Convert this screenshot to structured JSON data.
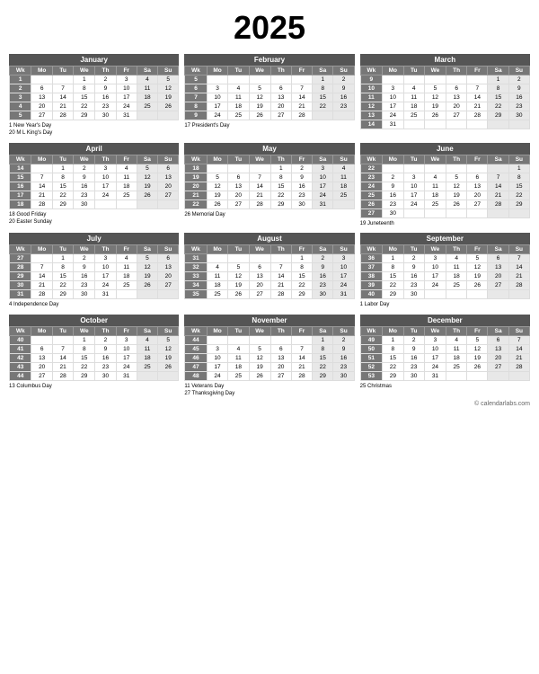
{
  "title": "2025",
  "footer": "© calendarlabs.com",
  "months": [
    {
      "name": "January",
      "headers": [
        "Wk",
        "Mo",
        "Tu",
        "We",
        "Th",
        "Fr",
        "Sa",
        "Su"
      ],
      "rows": [
        [
          "1",
          "",
          "",
          "1",
          "2",
          "3",
          "4",
          "5"
        ],
        [
          "2",
          "6",
          "7",
          "8",
          "9",
          "10",
          "11",
          "12"
        ],
        [
          "3",
          "13",
          "14",
          "15",
          "16",
          "17",
          "18",
          "19"
        ],
        [
          "4",
          "20",
          "21",
          "22",
          "23",
          "24",
          "25",
          "26"
        ],
        [
          "5",
          "27",
          "28",
          "29",
          "30",
          "31",
          "",
          ""
        ]
      ],
      "holidays": [
        "1  New Year's Day",
        "20  M L King's Day"
      ]
    },
    {
      "name": "February",
      "headers": [
        "Wk",
        "Mo",
        "Tu",
        "We",
        "Th",
        "Fr",
        "Sa",
        "Su"
      ],
      "rows": [
        [
          "5",
          "",
          "",
          "",
          "",
          "",
          "1",
          "2"
        ],
        [
          "6",
          "3",
          "4",
          "5",
          "6",
          "7",
          "8",
          "9"
        ],
        [
          "7",
          "10",
          "11",
          "12",
          "13",
          "14",
          "15",
          "16"
        ],
        [
          "8",
          "17",
          "18",
          "19",
          "20",
          "21",
          "22",
          "23"
        ],
        [
          "9",
          "24",
          "25",
          "26",
          "27",
          "28",
          "",
          ""
        ]
      ],
      "holidays": [
        "17  President's Day"
      ]
    },
    {
      "name": "March",
      "headers": [
        "Wk",
        "Mo",
        "Tu",
        "We",
        "Th",
        "Fr",
        "Sa",
        "Su"
      ],
      "rows": [
        [
          "9",
          "",
          "",
          "",
          "",
          "",
          "1",
          "2"
        ],
        [
          "10",
          "3",
          "4",
          "5",
          "6",
          "7",
          "8",
          "9"
        ],
        [
          "11",
          "10",
          "11",
          "12",
          "13",
          "14",
          "15",
          "16"
        ],
        [
          "12",
          "17",
          "18",
          "19",
          "20",
          "21",
          "22",
          "23"
        ],
        [
          "13",
          "24",
          "25",
          "26",
          "27",
          "28",
          "29",
          "30"
        ],
        [
          "14",
          "31",
          "",
          "",
          "",
          "",
          "",
          ""
        ]
      ],
      "holidays": []
    },
    {
      "name": "April",
      "headers": [
        "Wk",
        "Mo",
        "Tu",
        "We",
        "Th",
        "Fr",
        "Sa",
        "Su"
      ],
      "rows": [
        [
          "14",
          "",
          "1",
          "2",
          "3",
          "4",
          "5",
          "6"
        ],
        [
          "15",
          "7",
          "8",
          "9",
          "10",
          "11",
          "12",
          "13"
        ],
        [
          "16",
          "14",
          "15",
          "16",
          "17",
          "18",
          "19",
          "20"
        ],
        [
          "17",
          "21",
          "22",
          "23",
          "24",
          "25",
          "26",
          "27"
        ],
        [
          "18",
          "28",
          "29",
          "30",
          "",
          "",
          "",
          ""
        ]
      ],
      "holidays": [
        "18  Good Friday",
        "20  Easter Sunday"
      ]
    },
    {
      "name": "May",
      "headers": [
        "Wk",
        "Mo",
        "Tu",
        "We",
        "Th",
        "Fr",
        "Sa",
        "Su"
      ],
      "rows": [
        [
          "18",
          "",
          "",
          "",
          "1",
          "2",
          "3",
          "4"
        ],
        [
          "19",
          "5",
          "6",
          "7",
          "8",
          "9",
          "10",
          "11"
        ],
        [
          "20",
          "12",
          "13",
          "14",
          "15",
          "16",
          "17",
          "18"
        ],
        [
          "21",
          "19",
          "20",
          "21",
          "22",
          "23",
          "24",
          "25"
        ],
        [
          "22",
          "26",
          "27",
          "28",
          "29",
          "30",
          "31",
          ""
        ]
      ],
      "holidays": [
        "26  Memorial Day"
      ]
    },
    {
      "name": "June",
      "headers": [
        "Wk",
        "Mo",
        "Tu",
        "We",
        "Th",
        "Fr",
        "Sa",
        "Su"
      ],
      "rows": [
        [
          "22",
          "",
          "",
          "",
          "",
          "",
          "",
          "1"
        ],
        [
          "23",
          "2",
          "3",
          "4",
          "5",
          "6",
          "7",
          "8"
        ],
        [
          "24",
          "9",
          "10",
          "11",
          "12",
          "13",
          "14",
          "15"
        ],
        [
          "25",
          "16",
          "17",
          "18",
          "19",
          "20",
          "21",
          "22"
        ],
        [
          "26",
          "23",
          "24",
          "25",
          "26",
          "27",
          "28",
          "29"
        ],
        [
          "27",
          "30",
          "",
          "",
          "",
          "",
          "",
          ""
        ]
      ],
      "holidays": [
        "19  Juneteenth"
      ]
    },
    {
      "name": "July",
      "headers": [
        "Wk",
        "Mo",
        "Tu",
        "We",
        "Th",
        "Fr",
        "Sa",
        "Su"
      ],
      "rows": [
        [
          "27",
          "",
          "1",
          "2",
          "3",
          "4",
          "5",
          "6"
        ],
        [
          "28",
          "7",
          "8",
          "9",
          "10",
          "11",
          "12",
          "13"
        ],
        [
          "29",
          "14",
          "15",
          "16",
          "17",
          "18",
          "19",
          "20"
        ],
        [
          "30",
          "21",
          "22",
          "23",
          "24",
          "25",
          "26",
          "27"
        ],
        [
          "31",
          "28",
          "29",
          "30",
          "31",
          "",
          "",
          ""
        ]
      ],
      "holidays": [
        "4  Independence Day"
      ]
    },
    {
      "name": "August",
      "headers": [
        "Wk",
        "Mo",
        "Tu",
        "We",
        "Th",
        "Fr",
        "Sa",
        "Su"
      ],
      "rows": [
        [
          "31",
          "",
          "",
          "",
          "",
          "1",
          "2",
          "3"
        ],
        [
          "32",
          "4",
          "5",
          "6",
          "7",
          "8",
          "9",
          "10"
        ],
        [
          "33",
          "11",
          "12",
          "13",
          "14",
          "15",
          "16",
          "17"
        ],
        [
          "34",
          "18",
          "19",
          "20",
          "21",
          "22",
          "23",
          "24"
        ],
        [
          "35",
          "25",
          "26",
          "27",
          "28",
          "29",
          "30",
          "31"
        ]
      ],
      "holidays": []
    },
    {
      "name": "September",
      "headers": [
        "Wk",
        "Mo",
        "Tu",
        "We",
        "Th",
        "Fr",
        "Sa",
        "Su"
      ],
      "rows": [
        [
          "36",
          "1",
          "2",
          "3",
          "4",
          "5",
          "6",
          "7"
        ],
        [
          "37",
          "8",
          "9",
          "10",
          "11",
          "12",
          "13",
          "14"
        ],
        [
          "38",
          "15",
          "16",
          "17",
          "18",
          "19",
          "20",
          "21"
        ],
        [
          "39",
          "22",
          "23",
          "24",
          "25",
          "26",
          "27",
          "28"
        ],
        [
          "40",
          "29",
          "30",
          "",
          "",
          "",
          "",
          ""
        ]
      ],
      "holidays": [
        "1  Labor Day"
      ]
    },
    {
      "name": "October",
      "headers": [
        "Wk",
        "Mo",
        "Tu",
        "We",
        "Th",
        "Fr",
        "Sa",
        "Su"
      ],
      "rows": [
        [
          "40",
          "",
          "",
          "1",
          "2",
          "3",
          "4",
          "5"
        ],
        [
          "41",
          "6",
          "7",
          "8",
          "9",
          "10",
          "11",
          "12"
        ],
        [
          "42",
          "13",
          "14",
          "15",
          "16",
          "17",
          "18",
          "19"
        ],
        [
          "43",
          "20",
          "21",
          "22",
          "23",
          "24",
          "25",
          "26"
        ],
        [
          "44",
          "27",
          "28",
          "29",
          "30",
          "31",
          "",
          ""
        ]
      ],
      "holidays": [
        "13  Columbus Day"
      ]
    },
    {
      "name": "November",
      "headers": [
        "Wk",
        "Mo",
        "Tu",
        "We",
        "Th",
        "Fr",
        "Sa",
        "Su"
      ],
      "rows": [
        [
          "44",
          "",
          "",
          "",
          "",
          "",
          "1",
          "2"
        ],
        [
          "45",
          "3",
          "4",
          "5",
          "6",
          "7",
          "8",
          "9"
        ],
        [
          "46",
          "10",
          "11",
          "12",
          "13",
          "14",
          "15",
          "16"
        ],
        [
          "47",
          "17",
          "18",
          "19",
          "20",
          "21",
          "22",
          "23"
        ],
        [
          "48",
          "24",
          "25",
          "26",
          "27",
          "28",
          "29",
          "30"
        ]
      ],
      "holidays": [
        "11  Veterans Day",
        "27  Thanksgiving Day"
      ]
    },
    {
      "name": "December",
      "headers": [
        "Wk",
        "Mo",
        "Tu",
        "We",
        "Th",
        "Fr",
        "Sa",
        "Su"
      ],
      "rows": [
        [
          "49",
          "1",
          "2",
          "3",
          "4",
          "5",
          "6",
          "7"
        ],
        [
          "50",
          "8",
          "9",
          "10",
          "11",
          "12",
          "13",
          "14"
        ],
        [
          "51",
          "15",
          "16",
          "17",
          "18",
          "19",
          "20",
          "21"
        ],
        [
          "52",
          "22",
          "23",
          "24",
          "25",
          "26",
          "27",
          "28"
        ],
        [
          "53",
          "29",
          "30",
          "31",
          "",
          "",
          "",
          ""
        ]
      ],
      "holidays": [
        "25  Christmas"
      ]
    }
  ]
}
